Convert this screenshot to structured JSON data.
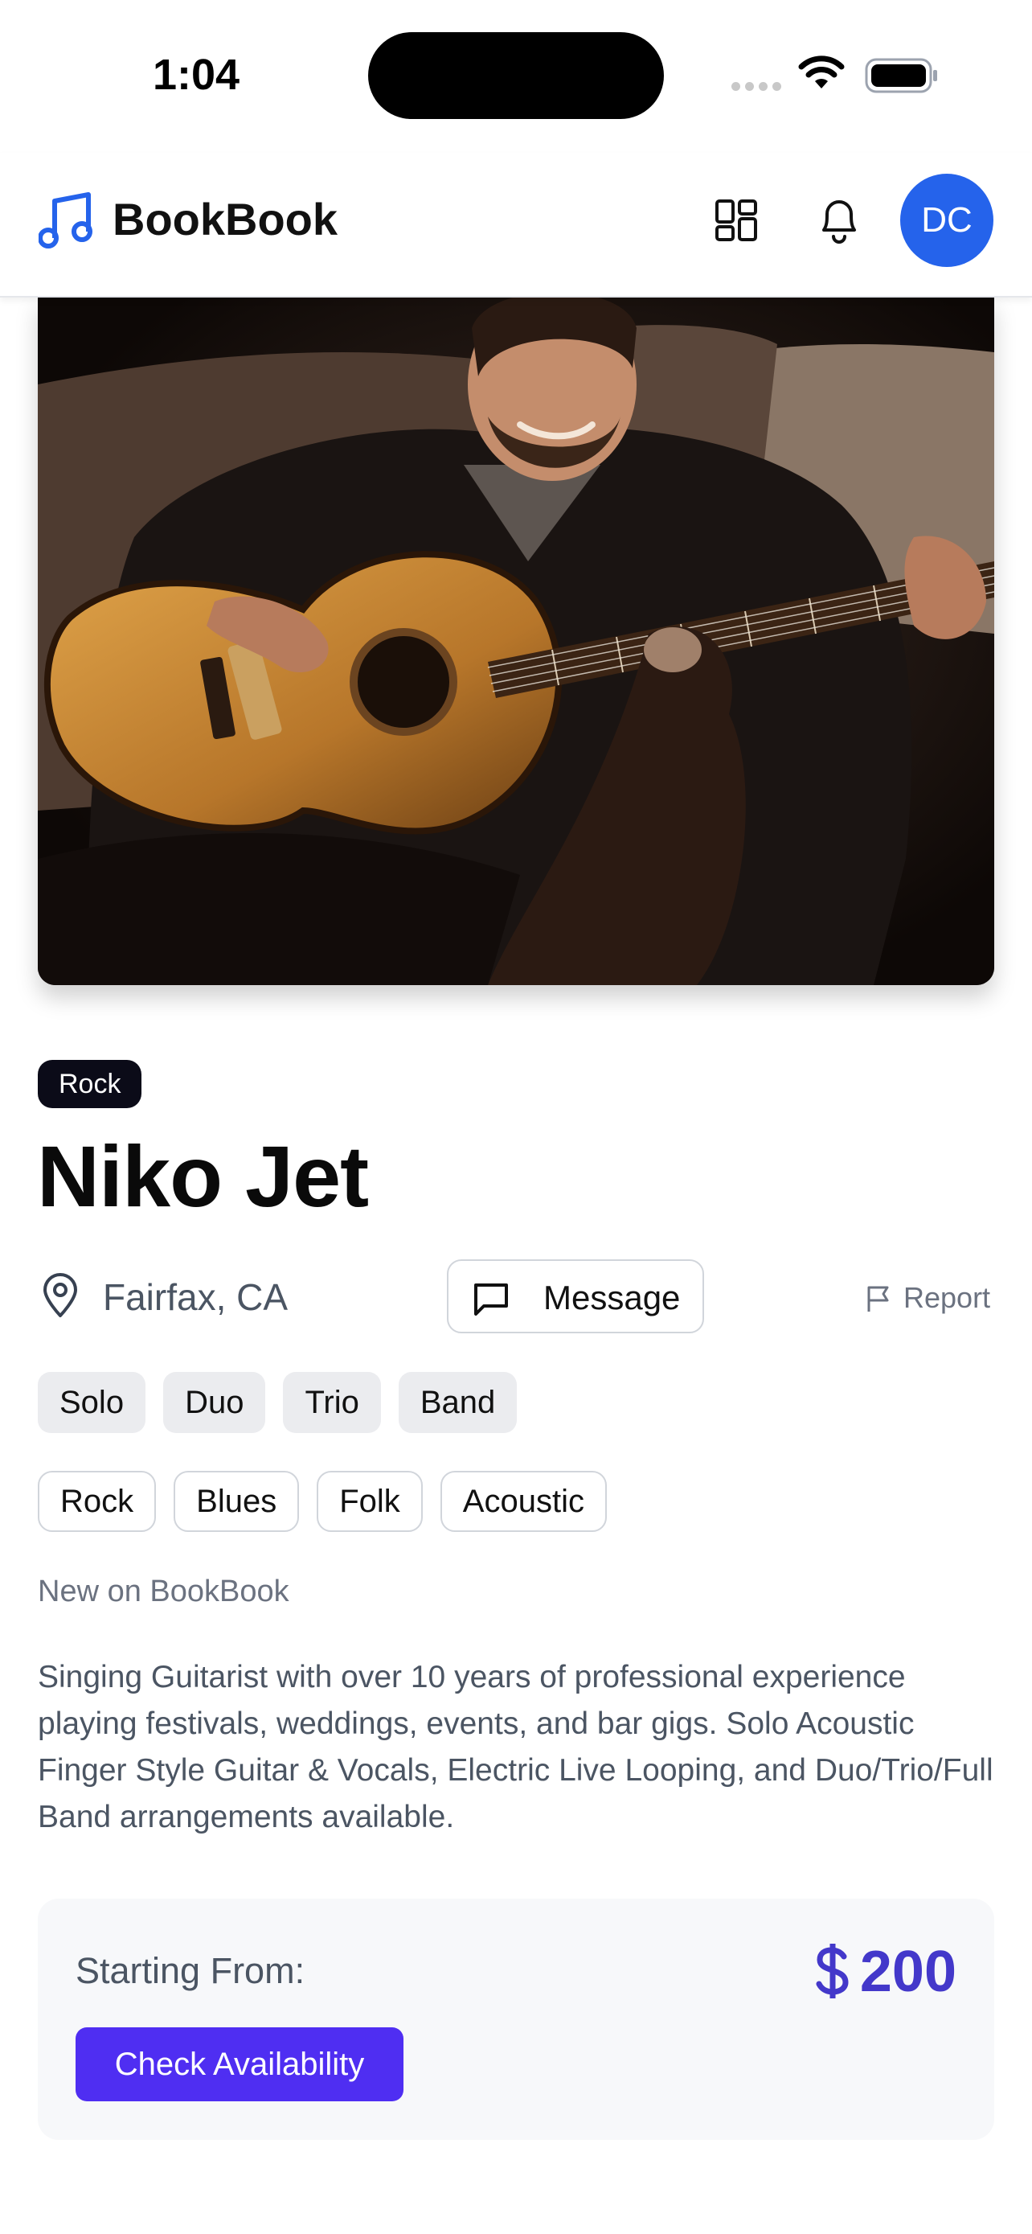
{
  "status_bar": {
    "time": "1:04"
  },
  "header": {
    "brand": "BookBook",
    "avatar_initials": "DC"
  },
  "profile": {
    "genre_badge": "Rock",
    "name": "Niko Jet",
    "location": "Fairfax, CA",
    "message_label": "Message",
    "report_label": "Report",
    "ensemble_sizes": [
      "Solo",
      "Duo",
      "Trio",
      "Band"
    ],
    "genres": [
      "Rock",
      "Blues",
      "Folk",
      "Acoustic"
    ],
    "new_label": "New on BookBook",
    "bio": "Singing Guitarist with over 10 years of professional experience playing festivals, weddings, events, and bar gigs. Solo Acoustic Finger Style Guitar & Vocals, Electric Live Looping, and Duo/Trio/Full Band arrangements available."
  },
  "pricing": {
    "label": "Starting From:",
    "currency_symbol": "$",
    "amount": "200",
    "cta_label": "Check Availability"
  },
  "colors": {
    "accent": "#4f2ef2",
    "price": "#4338ca",
    "avatar": "#2563eb",
    "logo": "#2563eb",
    "badge": "#0b0b18"
  },
  "icons": [
    "music-note-icon",
    "grid-icon",
    "bell-icon",
    "map-pin-icon",
    "message-icon",
    "flag-icon",
    "dollar-icon",
    "wifi-icon",
    "battery-icon",
    "signal-icon"
  ]
}
